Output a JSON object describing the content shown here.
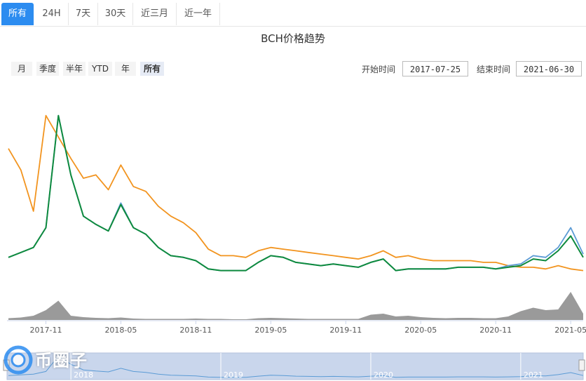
{
  "tabs": [
    {
      "label": "所有"
    },
    {
      "label": "24H"
    },
    {
      "label": "7天"
    },
    {
      "label": "30天"
    },
    {
      "label": "近三月"
    },
    {
      "label": "近一年"
    }
  ],
  "range_buttons": [
    {
      "label": "月"
    },
    {
      "label": "季度"
    },
    {
      "label": "半年"
    },
    {
      "label": "YTD"
    },
    {
      "label": "年"
    },
    {
      "label": "所有"
    }
  ],
  "dates": {
    "start_label": "开始时间",
    "start_value": "2017-07-25",
    "end_label": "结束时间",
    "end_value": "2021-06-30"
  },
  "logo": {
    "text": "币圈子"
  },
  "colors": {
    "orange": "#f2941f",
    "green": "#0e8a3e",
    "blue": "#5b9bd5",
    "volume": "#9a9a9a",
    "accent": "#2c8cf0"
  },
  "chart_data": {
    "type": "line",
    "title": "BCH价格趋势",
    "x_ticks": [
      "2017-11",
      "2018-05",
      "2018-11",
      "2019-05",
      "2019-11",
      "2020-05",
      "2020-11",
      "2021-05"
    ],
    "navigator_labels": [
      "2018",
      "2019",
      "2020",
      "2021"
    ],
    "x": [
      "2017-08",
      "2017-09",
      "2017-10",
      "2017-11",
      "2017-12",
      "2018-01",
      "2018-02",
      "2018-03",
      "2018-04",
      "2018-05",
      "2018-06",
      "2018-07",
      "2018-08",
      "2018-09",
      "2018-10",
      "2018-11",
      "2018-12",
      "2019-01",
      "2019-02",
      "2019-03",
      "2019-04",
      "2019-05",
      "2019-06",
      "2019-07",
      "2019-08",
      "2019-09",
      "2019-10",
      "2019-11",
      "2019-12",
      "2020-01",
      "2020-02",
      "2020-03",
      "2020-04",
      "2020-05",
      "2020-06",
      "2020-07",
      "2020-08",
      "2020-09",
      "2020-10",
      "2020-11",
      "2020-12",
      "2021-01",
      "2021-02",
      "2021-03",
      "2021-04",
      "2021-05",
      "2021-06"
    ],
    "series": [
      {
        "color": "#f2941f",
        "values": [
          0.78,
          0.65,
          0.4,
          0.98,
          0.85,
          0.72,
          0.6,
          0.62,
          0.53,
          0.68,
          0.55,
          0.52,
          0.43,
          0.37,
          0.33,
          0.27,
          0.17,
          0.13,
          0.13,
          0.12,
          0.16,
          0.18,
          0.17,
          0.16,
          0.15,
          0.14,
          0.13,
          0.12,
          0.11,
          0.13,
          0.16,
          0.12,
          0.13,
          0.11,
          0.1,
          0.1,
          0.1,
          0.1,
          0.09,
          0.09,
          0.07,
          0.06,
          0.06,
          0.05,
          0.07,
          0.05,
          0.04
        ]
      },
      {
        "color": "#5b9bd5",
        "values": [
          0.12,
          0.15,
          0.18,
          0.3,
          0.98,
          0.62,
          0.37,
          0.32,
          0.28,
          0.45,
          0.3,
          0.26,
          0.18,
          0.13,
          0.12,
          0.1,
          0.05,
          0.04,
          0.04,
          0.04,
          0.09,
          0.13,
          0.12,
          0.09,
          0.08,
          0.07,
          0.08,
          0.07,
          0.06,
          0.09,
          0.11,
          0.04,
          0.05,
          0.05,
          0.05,
          0.05,
          0.06,
          0.06,
          0.06,
          0.05,
          0.07,
          0.08,
          0.13,
          0.12,
          0.18,
          0.3,
          0.14
        ]
      },
      {
        "color": "#0e8a3e",
        "values": [
          0.12,
          0.15,
          0.18,
          0.3,
          0.98,
          0.62,
          0.37,
          0.32,
          0.28,
          0.44,
          0.3,
          0.26,
          0.18,
          0.13,
          0.12,
          0.1,
          0.05,
          0.04,
          0.04,
          0.04,
          0.09,
          0.13,
          0.12,
          0.09,
          0.08,
          0.07,
          0.08,
          0.07,
          0.06,
          0.09,
          0.11,
          0.04,
          0.05,
          0.05,
          0.05,
          0.05,
          0.06,
          0.06,
          0.06,
          0.05,
          0.06,
          0.07,
          0.11,
          0.1,
          0.16,
          0.25,
          0.12
        ]
      }
    ],
    "volume": [
      0.05,
      0.07,
      0.12,
      0.28,
      0.55,
      0.12,
      0.08,
      0.06,
      0.05,
      0.07,
      0.04,
      0.03,
      0.03,
      0.03,
      0.03,
      0.04,
      0.03,
      0.03,
      0.02,
      0.02,
      0.05,
      0.06,
      0.05,
      0.04,
      0.03,
      0.03,
      0.03,
      0.03,
      0.03,
      0.15,
      0.18,
      0.1,
      0.12,
      0.08,
      0.06,
      0.05,
      0.06,
      0.06,
      0.05,
      0.05,
      0.1,
      0.25,
      0.35,
      0.28,
      0.3,
      0.8,
      0.18
    ],
    "grid": false,
    "legend": "none"
  }
}
